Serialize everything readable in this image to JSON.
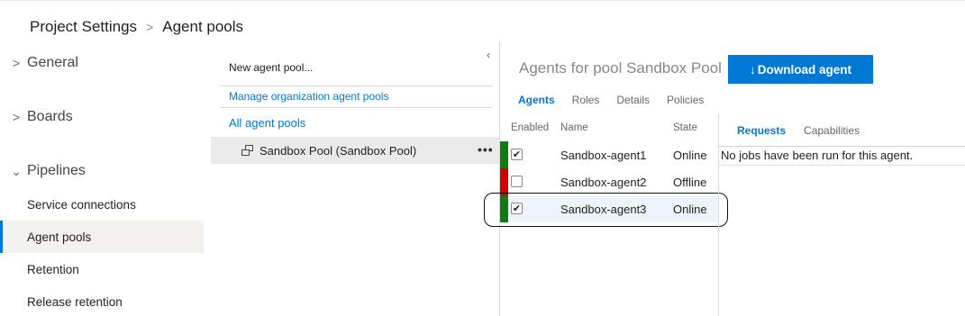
{
  "breadcrumb": {
    "project_settings": "Project Settings",
    "separator": ">",
    "agent_pools": "Agent pools"
  },
  "left_nav": {
    "general": "General",
    "boards": "Boards",
    "pipelines": "Pipelines",
    "items": [
      {
        "label": "Service connections"
      },
      {
        "label": "Agent pools",
        "selected": true
      },
      {
        "label": "Retention"
      },
      {
        "label": "Release retention"
      }
    ],
    "chevron_collapsed": ">",
    "chevron_expanded": "⌄"
  },
  "pools_panel": {
    "collapse_glyph": "‹",
    "new_pool": "New agent pool...",
    "manage_link": "Manage organization agent pools",
    "all_pools": "All agent pools",
    "pool_name": "Sandbox Pool (Sandbox Pool)",
    "more_glyph": "•••"
  },
  "agents": {
    "title": "Agents for pool Sandbox Pool",
    "download_label": "Download agent",
    "download_icon_glyph": "↓",
    "tabs": [
      "Agents",
      "Roles",
      "Details",
      "Policies"
    ],
    "columns": {
      "enabled": "Enabled",
      "name": "Name",
      "state": "State"
    },
    "rows": [
      {
        "name": "Sandbox-agent1",
        "state": "Online",
        "enabled": true,
        "status_color": "#107c10"
      },
      {
        "name": "Sandbox-agent2",
        "state": "Offline",
        "enabled": false,
        "status_color": "#d00000"
      },
      {
        "name": "Sandbox-agent3",
        "state": "Online",
        "enabled": true,
        "status_color": "#107c10"
      }
    ]
  },
  "requests": {
    "tabs": [
      "Requests",
      "Capabilities"
    ],
    "empty_message": "No jobs have been run for this agent."
  },
  "colors": {
    "accent": "#0078d4",
    "online": "#107c10",
    "offline": "#d00000"
  }
}
